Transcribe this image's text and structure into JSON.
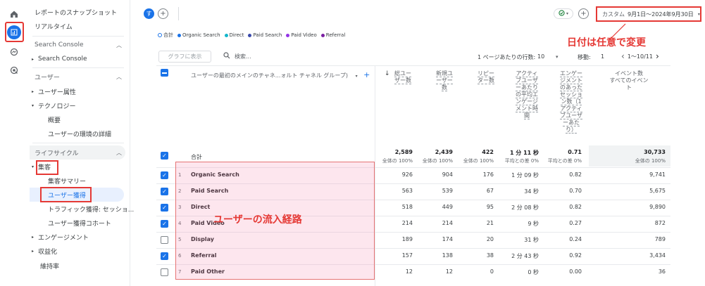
{
  "colors": {
    "accent": "#1a73e8",
    "annotation_red": "#e53935",
    "success_green": "#188038"
  },
  "rail": {
    "icons": [
      "home-icon",
      "reports-icon",
      "explore-icon",
      "advertising-icon"
    ]
  },
  "sidebar": {
    "snapshot": "レポートのスナップショット",
    "realtime": "リアルタイム",
    "search_console_section": "Search Console",
    "search_console_item": "Search Console",
    "user_section": "ユーザー",
    "user_attributes": "ユーザー属性",
    "technology": "テクノロジー",
    "overview": "概要",
    "user_env_details": "ユーザーの環境の詳細",
    "lifecycle_section": "ライフサイクル",
    "acquisition": "集客",
    "acquisition_summary": "集客サマリー",
    "user_acquisition": "ユーザー獲得",
    "traffic_acquisition": "トラフィック獲得: セッショ...",
    "user_acquisition_cohort": "ユーザー獲得コホート",
    "engagement": "エンゲージメント",
    "monetization": "収益化",
    "retention": "維持率"
  },
  "topbar": {
    "avatar_letter": "す",
    "date_label": "カスタム",
    "date_range": "9月1日～2024年9月30日"
  },
  "annotations": {
    "date_note": "日付は任意で変更",
    "channel_note": "ユーザーの流入経路"
  },
  "legend": {
    "items": [
      {
        "label": "合計",
        "color": "#1a73e8"
      },
      {
        "label": "Organic Search",
        "color": "#1a73e8"
      },
      {
        "label": "Direct",
        "color": "#12b5cb"
      },
      {
        "label": "Paid Search",
        "color": "#3949ab"
      },
      {
        "label": "Paid Video",
        "color": "#9334e6"
      },
      {
        "label": "Referral",
        "color": "#7b1fa2"
      }
    ]
  },
  "toolbar": {
    "graph_button": "グラフに表示",
    "search_placeholder": "検索...",
    "rows_per_page_label": "1 ページあたりの行数:",
    "rows_per_page_value": "10",
    "move_label": "移動:",
    "move_value": "1",
    "pager_text": "1～10/11"
  },
  "table": {
    "dimension_header": "ユーザーの最初のメインのチャネ...ォルト チャネル グループ)",
    "total_label": "合計",
    "columns": [
      {
        "header": "総ユー\nザー数",
        "total": "2,589",
        "total_sub": "全体の 100%"
      },
      {
        "header": "新規ユ\nーザー\n数",
        "total": "2,439",
        "total_sub": "全体の 100%"
      },
      {
        "header": "リピー\nター数",
        "total": "422",
        "total_sub": "全体の 100%"
      },
      {
        "header": "アクティ\nブユーザ\nーあたり\nの平均エ\nンゲージ\nメント時\n間",
        "total": "1 分 11 秒",
        "total_sub": "平均との差 0%"
      },
      {
        "header": "エンゲー\nジメント\nのあった\nセッショ\nン数（1\nアクティ\nブユーザ\nーあた\nり）",
        "total": "0.71",
        "total_sub": "平均との差 0%"
      },
      {
        "header": "イベント数\nすべてのイベント",
        "total": "30,733",
        "total_sub": "全体の 100%"
      }
    ],
    "rows": [
      {
        "num": "1",
        "name": "Organic Search",
        "checked": true,
        "values": [
          "926",
          "904",
          "176",
          "1 分 09 秒",
          "0.82",
          "9,741"
        ]
      },
      {
        "num": "2",
        "name": "Paid Search",
        "checked": true,
        "values": [
          "563",
          "539",
          "67",
          "34 秒",
          "0.70",
          "5,675"
        ]
      },
      {
        "num": "3",
        "name": "Direct",
        "checked": true,
        "values": [
          "518",
          "449",
          "95",
          "2 分 08 秒",
          "0.82",
          "9,890"
        ]
      },
      {
        "num": "4",
        "name": "Paid Video",
        "checked": true,
        "values": [
          "214",
          "214",
          "21",
          "9 秒",
          "0.27",
          "872"
        ]
      },
      {
        "num": "5",
        "name": "Display",
        "checked": false,
        "values": [
          "189",
          "174",
          "20",
          "31 秒",
          "0.24",
          "789"
        ]
      },
      {
        "num": "6",
        "name": "Referral",
        "checked": true,
        "values": [
          "157",
          "138",
          "38",
          "2 分 43 秒",
          "0.92",
          "3,434"
        ]
      },
      {
        "num": "7",
        "name": "Paid Other",
        "checked": false,
        "values": [
          "12",
          "12",
          "0",
          "0 秒",
          "0.00",
          "36"
        ]
      }
    ]
  }
}
